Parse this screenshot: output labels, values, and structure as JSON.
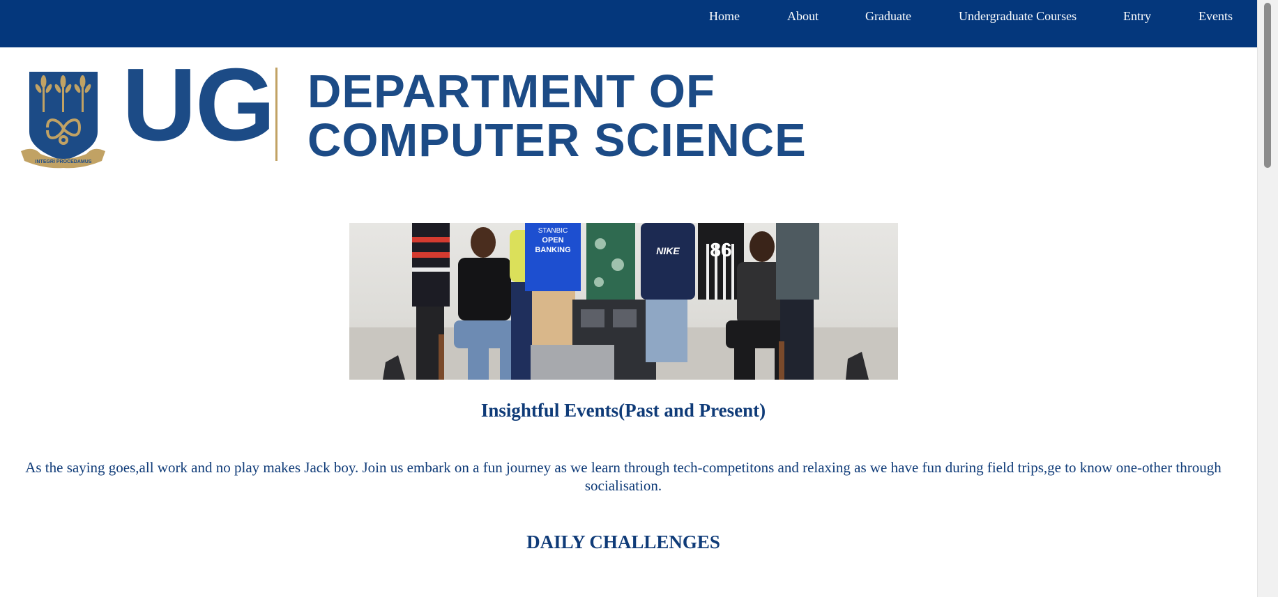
{
  "nav": {
    "items": [
      {
        "label": "Home"
      },
      {
        "label": "About"
      },
      {
        "label": "Graduate"
      },
      {
        "label": "Undergraduate Courses"
      },
      {
        "label": "Entry"
      },
      {
        "label": "Events"
      }
    ]
  },
  "logo": {
    "acronym": "UG",
    "department_line1": "DEPARTMENT OF",
    "department_line2": "COMPUTER SCIENCE",
    "motto": "INTEGRI PROCEDAMUS"
  },
  "hero": {
    "shirt_text_1": "STANBIC",
    "shirt_text_2": "OPEN",
    "shirt_text_3": "BANKING",
    "shirt_text_4": "NIKE",
    "shirt_text_5": "86"
  },
  "events": {
    "title": "Insightful Events(Past and Present)",
    "intro": "As the saying goes,all work and no play makes Jack boy. Join us embark on a fun journey as we learn through tech-competitons and relaxing as we have fun during field trips,ge to know one-other through socialisation."
  },
  "challenges": {
    "title": "DAILY CHALLENGES"
  },
  "colors": {
    "nav_bg": "#04377c",
    "brand_blue": "#1c4b86",
    "heading_blue": "#0f3b78",
    "gold": "#c1a264"
  }
}
